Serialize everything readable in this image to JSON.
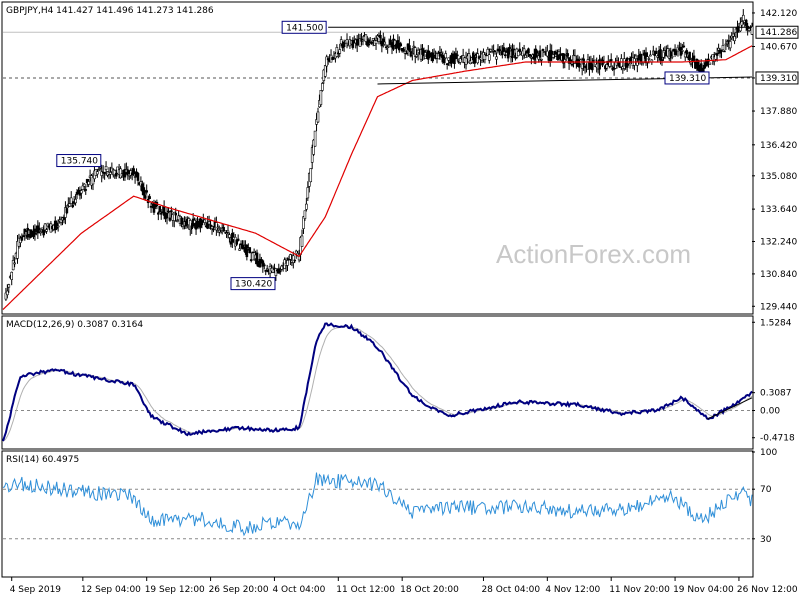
{
  "colors": {
    "candle": "#000000",
    "ma": "#e00000",
    "macd_line": "#000080",
    "signal_line": "#b0b0b0",
    "rsi_line": "#2f8fd8",
    "trendline": "#000000",
    "label_box": "#000080",
    "grid_dash": "#888888"
  },
  "watermark": "ActionForex.com",
  "chart_data": [
    {
      "type": "candlestick",
      "title": "GBPJPY,H4 141.427 141.496 141.273 141.286",
      "y_ticks": [
        "142.120",
        "140.670",
        "139.310",
        "137.880",
        "136.420",
        "135.080",
        "133.640",
        "132.240",
        "130.840",
        "129.440"
      ],
      "y_tick_values": [
        142.12,
        140.67,
        139.31,
        137.88,
        136.42,
        135.08,
        133.64,
        132.24,
        130.84,
        129.44
      ],
      "ylim": [
        129.15,
        142.55
      ],
      "current_price": "141.286",
      "current_price_value": 141.286,
      "support_level": "139.310",
      "support_level_value": 139.31,
      "annotations": [
        {
          "text": "141.500",
          "x": "10 Oct 08:00",
          "value": 141.5,
          "anchor": "left"
        },
        {
          "text": "135.740",
          "x": "14 Sep 00:00",
          "value": 135.74,
          "anchor": "right"
        },
        {
          "text": "130.420",
          "x": "4 Oct 00:00",
          "value": 130.42,
          "anchor": "right"
        },
        {
          "text": "139.310",
          "x": "22 Nov 20:00",
          "value": 139.31,
          "anchor": "right"
        }
      ],
      "trendlines": [
        {
          "from": [
            "10 Oct 08:00",
            141.5
          ],
          "to": [
            "28 Nov 00:00",
            141.5
          ]
        },
        {
          "from": [
            "16 Oct 00:00",
            139.05
          ],
          "to": [
            "28 Nov 00:00",
            139.35
          ]
        }
      ],
      "close_anchors": [
        {
          "x": "3 Sep 08:00",
          "close": 130.0
        },
        {
          "x": "5 Sep 00:00",
          "close": 132.5
        },
        {
          "x": "9 Sep 00:00",
          "close": 132.9
        },
        {
          "x": "12 Sep 00:00",
          "close": 134.5
        },
        {
          "x": "14 Sep 00:00",
          "close": 135.3
        },
        {
          "x": "18 Sep 00:00",
          "close": 135.2
        },
        {
          "x": "20 Sep 00:00",
          "close": 133.8
        },
        {
          "x": "24 Sep 00:00",
          "close": 133.0
        },
        {
          "x": "27 Sep 00:00",
          "close": 133.0
        },
        {
          "x": "1 Oct 00:00",
          "close": 131.8
        },
        {
          "x": "4 Oct 00:00",
          "close": 130.9
        },
        {
          "x": "7 Oct 00:00",
          "close": 131.7
        },
        {
          "x": "8 Oct 00:00",
          "close": 134.5
        },
        {
          "x": "9 Oct 00:00",
          "close": 137.6
        },
        {
          "x": "10 Oct 00:00",
          "close": 140.0
        },
        {
          "x": "12 Oct 00:00",
          "close": 140.8
        },
        {
          "x": "16 Oct 00:00",
          "close": 141.0
        },
        {
          "x": "22 Oct 00:00",
          "close": 140.2
        },
        {
          "x": "26 Oct 00:00",
          "close": 140.1
        },
        {
          "x": "30 Oct 00:00",
          "close": 140.4
        },
        {
          "x": "5 Nov 00:00",
          "close": 140.3
        },
        {
          "x": "9 Nov 00:00",
          "close": 139.9
        },
        {
          "x": "13 Nov 00:00",
          "close": 139.9
        },
        {
          "x": "17 Nov 00:00",
          "close": 140.3
        },
        {
          "x": "20 Nov 00:00",
          "close": 140.5
        },
        {
          "x": "22 Nov 00:00",
          "close": 139.7
        },
        {
          "x": "25 Nov 00:00",
          "close": 140.6
        },
        {
          "x": "27 Nov 00:00",
          "close": 141.8
        },
        {
          "x": "28 Nov 00:00",
          "close": 141.3
        }
      ],
      "moving_average_anchors": [
        {
          "x": "3 Sep 00:00",
          "value": 129.3
        },
        {
          "x": "12 Sep 00:00",
          "value": 132.6
        },
        {
          "x": "18 Sep 00:00",
          "value": 134.2
        },
        {
          "x": "22 Sep 00:00",
          "value": 133.7
        },
        {
          "x": "2 Oct 00:00",
          "value": 132.6
        },
        {
          "x": "7 Oct 00:00",
          "value": 131.6
        },
        {
          "x": "10 Oct 00:00",
          "value": 133.3
        },
        {
          "x": "13 Oct 00:00",
          "value": 136.0
        },
        {
          "x": "16 Oct 00:00",
          "value": 138.5
        },
        {
          "x": "20 Oct 00:00",
          "value": 139.2
        },
        {
          "x": "26 Oct 00:00",
          "value": 139.6
        },
        {
          "x": "2 Nov 00:00",
          "value": 140.0
        },
        {
          "x": "10 Nov 00:00",
          "value": 140.0
        },
        {
          "x": "20 Nov 00:00",
          "value": 140.0
        },
        {
          "x": "25 Nov 00:00",
          "value": 140.1
        },
        {
          "x": "28 Nov 00:00",
          "value": 140.7
        }
      ]
    },
    {
      "type": "line",
      "title": "MACD(12,26,9) 0.3087 0.3164",
      "series": [
        {
          "name": "MACD",
          "role": "macd"
        },
        {
          "name": "Signal",
          "role": "signal"
        }
      ],
      "y_ticks": [
        "1.5284",
        "0.3087",
        "0.00",
        "-0.4718"
      ],
      "y_tick_values": [
        1.5284,
        0.3087,
        0.0,
        -0.4718
      ],
      "ylim": [
        -0.65,
        1.62
      ],
      "zero_line": 0.0,
      "macd_anchors": [
        {
          "x": "3 Sep 00:00",
          "value": -0.55
        },
        {
          "x": "5 Sep 00:00",
          "value": 0.6
        },
        {
          "x": "9 Sep 00:00",
          "value": 0.7
        },
        {
          "x": "14 Sep 00:00",
          "value": 0.55
        },
        {
          "x": "18 Sep 00:00",
          "value": 0.45
        },
        {
          "x": "20 Sep 00:00",
          "value": -0.1
        },
        {
          "x": "24 Sep 00:00",
          "value": -0.4
        },
        {
          "x": "30 Sep 00:00",
          "value": -0.3
        },
        {
          "x": "4 Oct 00:00",
          "value": -0.35
        },
        {
          "x": "7 Oct 00:00",
          "value": -0.3
        },
        {
          "x": "9 Oct 00:00",
          "value": 1.2
        },
        {
          "x": "10 Oct 00:00",
          "value": 1.5
        },
        {
          "x": "13 Oct 00:00",
          "value": 1.45
        },
        {
          "x": "16 Oct 00:00",
          "value": 1.1
        },
        {
          "x": "20 Oct 00:00",
          "value": 0.25
        },
        {
          "x": "24 Oct 00:00",
          "value": -0.1
        },
        {
          "x": "1 Nov 00:00",
          "value": 0.15
        },
        {
          "x": "8 Nov 00:00",
          "value": 0.1
        },
        {
          "x": "13 Nov 00:00",
          "value": -0.05
        },
        {
          "x": "17 Nov 00:00",
          "value": 0.0
        },
        {
          "x": "20 Nov 00:00",
          "value": 0.22
        },
        {
          "x": "23 Nov 00:00",
          "value": -0.15
        },
        {
          "x": "26 Nov 00:00",
          "value": 0.1
        },
        {
          "x": "28 Nov 00:00",
          "value": 0.3087
        }
      ],
      "trendline": {
        "from": [
          "22 Nov 20:00",
          -0.15
        ],
        "to": [
          "28 Nov 00:00",
          0.22
        ]
      }
    },
    {
      "type": "line",
      "title": "RSI(14) 60.4975",
      "series": [
        {
          "name": "RSI(14)"
        }
      ],
      "y_ticks": [
        "100",
        "70",
        "30"
      ],
      "y_tick_values": [
        100,
        70,
        30
      ],
      "ylim": [
        0,
        100
      ],
      "dashed_levels": [
        70,
        30
      ],
      "rsi_anchors": [
        {
          "x": "3 Sep 00:00",
          "value": 70
        },
        {
          "x": "5 Sep 00:00",
          "value": 74
        },
        {
          "x": "12 Sep 00:00",
          "value": 68
        },
        {
          "x": "18 Sep 00:00",
          "value": 64
        },
        {
          "x": "20 Sep 00:00",
          "value": 45
        },
        {
          "x": "26 Sep 00:00",
          "value": 46
        },
        {
          "x": "1 Oct 00:00",
          "value": 38
        },
        {
          "x": "4 Oct 00:00",
          "value": 44
        },
        {
          "x": "7 Oct 00:00",
          "value": 40
        },
        {
          "x": "9 Oct 00:00",
          "value": 78
        },
        {
          "x": "12 Oct 00:00",
          "value": 76
        },
        {
          "x": "16 Oct 00:00",
          "value": 74
        },
        {
          "x": "20 Oct 00:00",
          "value": 52
        },
        {
          "x": "26 Oct 00:00",
          "value": 55
        },
        {
          "x": "2 Nov 00:00",
          "value": 56
        },
        {
          "x": "8 Nov 00:00",
          "value": 52
        },
        {
          "x": "13 Nov 00:00",
          "value": 54
        },
        {
          "x": "19 Nov 00:00",
          "value": 64
        },
        {
          "x": "22 Nov 00:00",
          "value": 44
        },
        {
          "x": "25 Nov 00:00",
          "value": 60
        },
        {
          "x": "27 Nov 00:00",
          "value": 70
        },
        {
          "x": "28 Nov 00:00",
          "value": 60.5
        }
      ]
    }
  ],
  "x_axis": {
    "start": "3 Sep 2019 00:00",
    "end": "28 Nov 2019 00:00",
    "labels": [
      {
        "text": "4 Sep 2019",
        "at": "4 Sep 00:00"
      },
      {
        "text": "12 Sep 04:00",
        "at": "12 Sep 04:00"
      },
      {
        "text": "19 Sep 12:00",
        "at": "19 Sep 12:00"
      },
      {
        "text": "26 Sep 20:00",
        "at": "26 Sep 20:00"
      },
      {
        "text": "4 Oct 04:00",
        "at": "4 Oct 04:00"
      },
      {
        "text": "11 Oct 12:00",
        "at": "11 Oct 12:00"
      },
      {
        "text": "18 Oct 20:00",
        "at": "18 Oct 20:00"
      },
      {
        "text": "28 Oct 04:00",
        "at": "28 Oct 04:00"
      },
      {
        "text": "4 Nov 12:00",
        "at": "4 Nov 12:00"
      },
      {
        "text": "11 Nov 20:00",
        "at": "11 Nov 20:00"
      },
      {
        "text": "19 Nov 04:00",
        "at": "19 Nov 04:00"
      },
      {
        "text": "26 Nov 12:00",
        "at": "26 Nov 12:00"
      }
    ]
  }
}
